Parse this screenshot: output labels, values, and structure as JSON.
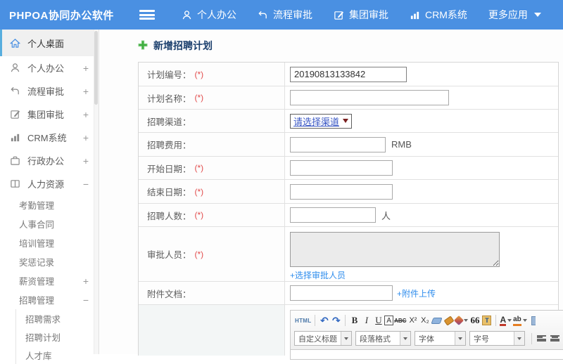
{
  "topbar": {
    "logo": "PHPOA协同办公软件",
    "nav": [
      {
        "label": "个人办公",
        "icon": "user-icon"
      },
      {
        "label": "流程审批",
        "icon": "flow-arrow-icon"
      },
      {
        "label": "集团审批",
        "icon": "edit-square-icon"
      },
      {
        "label": "CRM系统",
        "icon": "bar-chart-icon"
      },
      {
        "label": "更多应用",
        "icon": "caret-down-icon"
      }
    ]
  },
  "sidebar": {
    "items": [
      {
        "label": "个人桌面",
        "expand": ""
      },
      {
        "label": "个人办公",
        "expand": "+"
      },
      {
        "label": "流程审批",
        "expand": "+"
      },
      {
        "label": "集团审批",
        "expand": "+"
      },
      {
        "label": "CRM系统",
        "expand": "+"
      },
      {
        "label": "行政办公",
        "expand": "+"
      },
      {
        "label": "人力资源",
        "expand": "−"
      },
      {
        "label": "考勤管理",
        "expand": ""
      },
      {
        "label": "人事合同",
        "expand": ""
      },
      {
        "label": "培训管理",
        "expand": ""
      },
      {
        "label": "奖惩记录",
        "expand": ""
      },
      {
        "label": "薪资管理",
        "expand": "+"
      },
      {
        "label": "招聘管理",
        "expand": "−"
      },
      {
        "label": "招聘需求",
        "expand": ""
      },
      {
        "label": "招聘计划",
        "expand": ""
      },
      {
        "label": "人才库",
        "expand": ""
      }
    ]
  },
  "page": {
    "title": "新增招聘计划"
  },
  "form": {
    "rows": [
      {
        "label": "计划编号：",
        "required": "(*)",
        "value": "20190813133842"
      },
      {
        "label": "计划名称：",
        "required": "(*)",
        "value": ""
      },
      {
        "label": "招聘渠道：",
        "select_value": "请选择渠道"
      },
      {
        "label": "招聘费用：",
        "suffix": "RMB"
      },
      {
        "label": "开始日期：",
        "required": "(*)"
      },
      {
        "label": "结束日期：",
        "required": "(*)"
      },
      {
        "label": "招聘人数：",
        "required": "(*)",
        "suffix": "人"
      },
      {
        "label": "审批人员：",
        "required": "(*)",
        "link": "+选择审批人员"
      },
      {
        "label": "附件文档：",
        "link": "+附件上传"
      }
    ]
  },
  "editor": {
    "html_btn": "HTML",
    "undo": "↶",
    "redo": "↷",
    "bold": "B",
    "italic": "I",
    "underline": "U",
    "box_a": "A",
    "strike": "ABC",
    "sup": "X²",
    "sub": "X₂",
    "quote": "66",
    "paste": "T",
    "font_color": "A",
    "highlight": "ab",
    "combos": [
      "自定义标题",
      "段落格式",
      "字体",
      "字号"
    ]
  },
  "colors": {
    "accent": "#4a90e2",
    "link": "#2f8ded",
    "required": "#e24c4c",
    "plus_green": "#3fae3f",
    "active_border": "#58aede"
  }
}
